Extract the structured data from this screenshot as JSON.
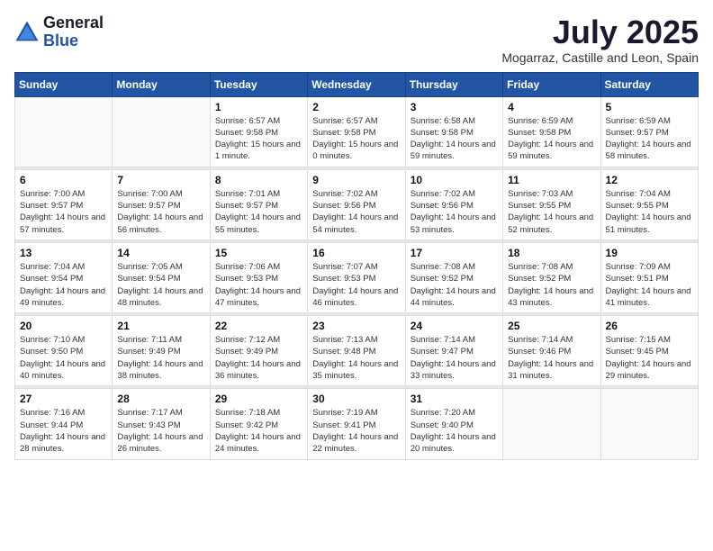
{
  "logo": {
    "general": "General",
    "blue": "Blue"
  },
  "header": {
    "month_year": "July 2025",
    "location": "Mogarraz, Castille and Leon, Spain"
  },
  "weekdays": [
    "Sunday",
    "Monday",
    "Tuesday",
    "Wednesday",
    "Thursday",
    "Friday",
    "Saturday"
  ],
  "weeks": [
    [
      {
        "day": "",
        "sunrise": "",
        "sunset": "",
        "daylight": ""
      },
      {
        "day": "",
        "sunrise": "",
        "sunset": "",
        "daylight": ""
      },
      {
        "day": "1",
        "sunrise": "Sunrise: 6:57 AM",
        "sunset": "Sunset: 9:58 PM",
        "daylight": "Daylight: 15 hours and 1 minute."
      },
      {
        "day": "2",
        "sunrise": "Sunrise: 6:57 AM",
        "sunset": "Sunset: 9:58 PM",
        "daylight": "Daylight: 15 hours and 0 minutes."
      },
      {
        "day": "3",
        "sunrise": "Sunrise: 6:58 AM",
        "sunset": "Sunset: 9:58 PM",
        "daylight": "Daylight: 14 hours and 59 minutes."
      },
      {
        "day": "4",
        "sunrise": "Sunrise: 6:59 AM",
        "sunset": "Sunset: 9:58 PM",
        "daylight": "Daylight: 14 hours and 59 minutes."
      },
      {
        "day": "5",
        "sunrise": "Sunrise: 6:59 AM",
        "sunset": "Sunset: 9:57 PM",
        "daylight": "Daylight: 14 hours and 58 minutes."
      }
    ],
    [
      {
        "day": "6",
        "sunrise": "Sunrise: 7:00 AM",
        "sunset": "Sunset: 9:57 PM",
        "daylight": "Daylight: 14 hours and 57 minutes."
      },
      {
        "day": "7",
        "sunrise": "Sunrise: 7:00 AM",
        "sunset": "Sunset: 9:57 PM",
        "daylight": "Daylight: 14 hours and 56 minutes."
      },
      {
        "day": "8",
        "sunrise": "Sunrise: 7:01 AM",
        "sunset": "Sunset: 9:57 PM",
        "daylight": "Daylight: 14 hours and 55 minutes."
      },
      {
        "day": "9",
        "sunrise": "Sunrise: 7:02 AM",
        "sunset": "Sunset: 9:56 PM",
        "daylight": "Daylight: 14 hours and 54 minutes."
      },
      {
        "day": "10",
        "sunrise": "Sunrise: 7:02 AM",
        "sunset": "Sunset: 9:56 PM",
        "daylight": "Daylight: 14 hours and 53 minutes."
      },
      {
        "day": "11",
        "sunrise": "Sunrise: 7:03 AM",
        "sunset": "Sunset: 9:55 PM",
        "daylight": "Daylight: 14 hours and 52 minutes."
      },
      {
        "day": "12",
        "sunrise": "Sunrise: 7:04 AM",
        "sunset": "Sunset: 9:55 PM",
        "daylight": "Daylight: 14 hours and 51 minutes."
      }
    ],
    [
      {
        "day": "13",
        "sunrise": "Sunrise: 7:04 AM",
        "sunset": "Sunset: 9:54 PM",
        "daylight": "Daylight: 14 hours and 49 minutes."
      },
      {
        "day": "14",
        "sunrise": "Sunrise: 7:05 AM",
        "sunset": "Sunset: 9:54 PM",
        "daylight": "Daylight: 14 hours and 48 minutes."
      },
      {
        "day": "15",
        "sunrise": "Sunrise: 7:06 AM",
        "sunset": "Sunset: 9:53 PM",
        "daylight": "Daylight: 14 hours and 47 minutes."
      },
      {
        "day": "16",
        "sunrise": "Sunrise: 7:07 AM",
        "sunset": "Sunset: 9:53 PM",
        "daylight": "Daylight: 14 hours and 46 minutes."
      },
      {
        "day": "17",
        "sunrise": "Sunrise: 7:08 AM",
        "sunset": "Sunset: 9:52 PM",
        "daylight": "Daylight: 14 hours and 44 minutes."
      },
      {
        "day": "18",
        "sunrise": "Sunrise: 7:08 AM",
        "sunset": "Sunset: 9:52 PM",
        "daylight": "Daylight: 14 hours and 43 minutes."
      },
      {
        "day": "19",
        "sunrise": "Sunrise: 7:09 AM",
        "sunset": "Sunset: 9:51 PM",
        "daylight": "Daylight: 14 hours and 41 minutes."
      }
    ],
    [
      {
        "day": "20",
        "sunrise": "Sunrise: 7:10 AM",
        "sunset": "Sunset: 9:50 PM",
        "daylight": "Daylight: 14 hours and 40 minutes."
      },
      {
        "day": "21",
        "sunrise": "Sunrise: 7:11 AM",
        "sunset": "Sunset: 9:49 PM",
        "daylight": "Daylight: 14 hours and 38 minutes."
      },
      {
        "day": "22",
        "sunrise": "Sunrise: 7:12 AM",
        "sunset": "Sunset: 9:49 PM",
        "daylight": "Daylight: 14 hours and 36 minutes."
      },
      {
        "day": "23",
        "sunrise": "Sunrise: 7:13 AM",
        "sunset": "Sunset: 9:48 PM",
        "daylight": "Daylight: 14 hours and 35 minutes."
      },
      {
        "day": "24",
        "sunrise": "Sunrise: 7:14 AM",
        "sunset": "Sunset: 9:47 PM",
        "daylight": "Daylight: 14 hours and 33 minutes."
      },
      {
        "day": "25",
        "sunrise": "Sunrise: 7:14 AM",
        "sunset": "Sunset: 9:46 PM",
        "daylight": "Daylight: 14 hours and 31 minutes."
      },
      {
        "day": "26",
        "sunrise": "Sunrise: 7:15 AM",
        "sunset": "Sunset: 9:45 PM",
        "daylight": "Daylight: 14 hours and 29 minutes."
      }
    ],
    [
      {
        "day": "27",
        "sunrise": "Sunrise: 7:16 AM",
        "sunset": "Sunset: 9:44 PM",
        "daylight": "Daylight: 14 hours and 28 minutes."
      },
      {
        "day": "28",
        "sunrise": "Sunrise: 7:17 AM",
        "sunset": "Sunset: 9:43 PM",
        "daylight": "Daylight: 14 hours and 26 minutes."
      },
      {
        "day": "29",
        "sunrise": "Sunrise: 7:18 AM",
        "sunset": "Sunset: 9:42 PM",
        "daylight": "Daylight: 14 hours and 24 minutes."
      },
      {
        "day": "30",
        "sunrise": "Sunrise: 7:19 AM",
        "sunset": "Sunset: 9:41 PM",
        "daylight": "Daylight: 14 hours and 22 minutes."
      },
      {
        "day": "31",
        "sunrise": "Sunrise: 7:20 AM",
        "sunset": "Sunset: 9:40 PM",
        "daylight": "Daylight: 14 hours and 20 minutes."
      },
      {
        "day": "",
        "sunrise": "",
        "sunset": "",
        "daylight": ""
      },
      {
        "day": "",
        "sunrise": "",
        "sunset": "",
        "daylight": ""
      }
    ]
  ]
}
